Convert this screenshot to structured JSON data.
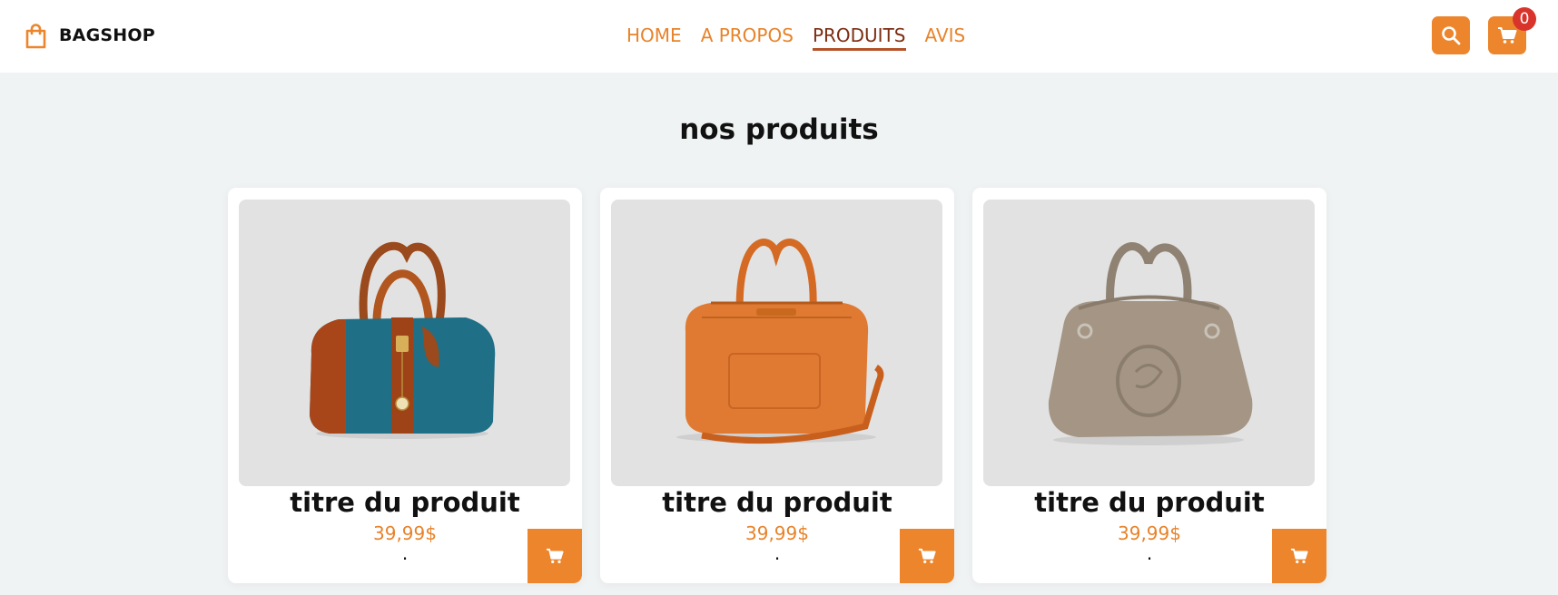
{
  "brand": {
    "name": "BAGSHOP",
    "icon": "shopping-bag-icon",
    "color": "#ec852b"
  },
  "nav": {
    "items": [
      {
        "label": "HOME",
        "active": false
      },
      {
        "label": "A PROPOS",
        "active": false
      },
      {
        "label": "PRODUITS",
        "active": true
      },
      {
        "label": "AVIS",
        "active": false
      }
    ]
  },
  "header_actions": {
    "search_icon": "search-icon",
    "cart_icon": "cart-icon",
    "cart_count": "0"
  },
  "section": {
    "title": "nos produits"
  },
  "products": [
    {
      "title": "titre du produit",
      "price": "39,99$",
      "note": ".",
      "image": "blue-croc-handbag"
    },
    {
      "title": "titre du produit",
      "price": "39,99$",
      "note": ".",
      "image": "orange-leather-duffel"
    },
    {
      "title": "titre du produit",
      "price": "39,99$",
      "note": ".",
      "image": "taupe-leather-handbag"
    }
  ],
  "colors": {
    "accent": "#ec852b",
    "nav_text": "#e8832a",
    "nav_active": "#7d2d12",
    "badge": "#d9342b"
  }
}
